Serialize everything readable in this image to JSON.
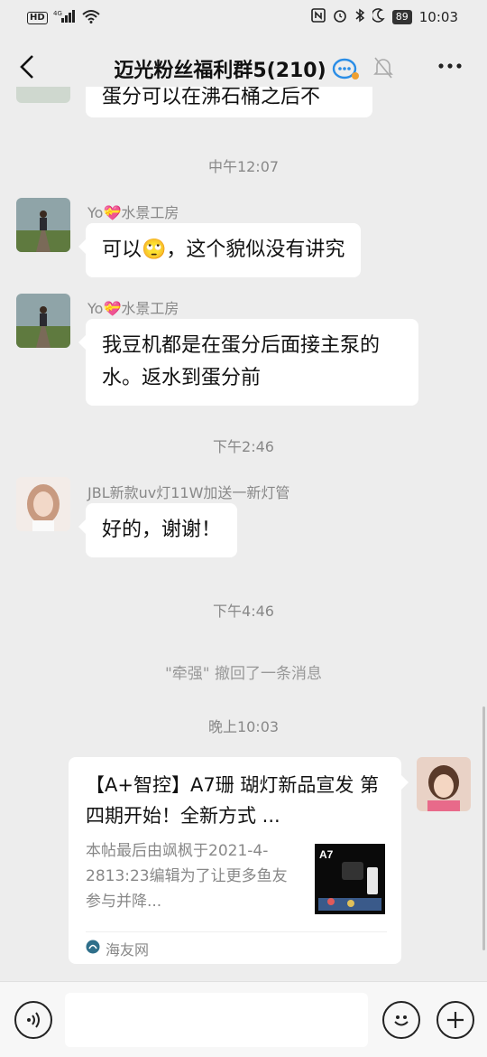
{
  "status_bar": {
    "network": "4G",
    "hd": "HD",
    "battery": "89",
    "time": "10:03"
  },
  "header": {
    "title": "迈光粉丝福利群5(210)"
  },
  "messages": {
    "partial_text": "蛋分可以在沸石桶之后不",
    "ts1": "中午12:07",
    "m1_sender": "Yo💝水景工房",
    "m1_text": "可以🙄，这个貌似没有讲究",
    "m2_sender": "Yo💝水景工房",
    "m2_text": "我豆机都是在蛋分后面接主泵的水。返水到蛋分前",
    "ts2": "下午2:46",
    "m3_sender": "JBL新款uv灯11W加送一新灯管",
    "m3_text": "好的，谢谢！",
    "ts3": "下午4:46",
    "recall": "\"牵强\" 撤回了一条消息",
    "ts4": "晚上10:03"
  },
  "card": {
    "title": "【A+智控】A7珊 瑚灯新品宣发  第四期开始！全新方式 ...",
    "desc": "本帖最后由飒枫于2021-4-2813:23编辑为了让更多鱼友参与并降...",
    "thumb_label": "A7",
    "source": "海友网"
  }
}
